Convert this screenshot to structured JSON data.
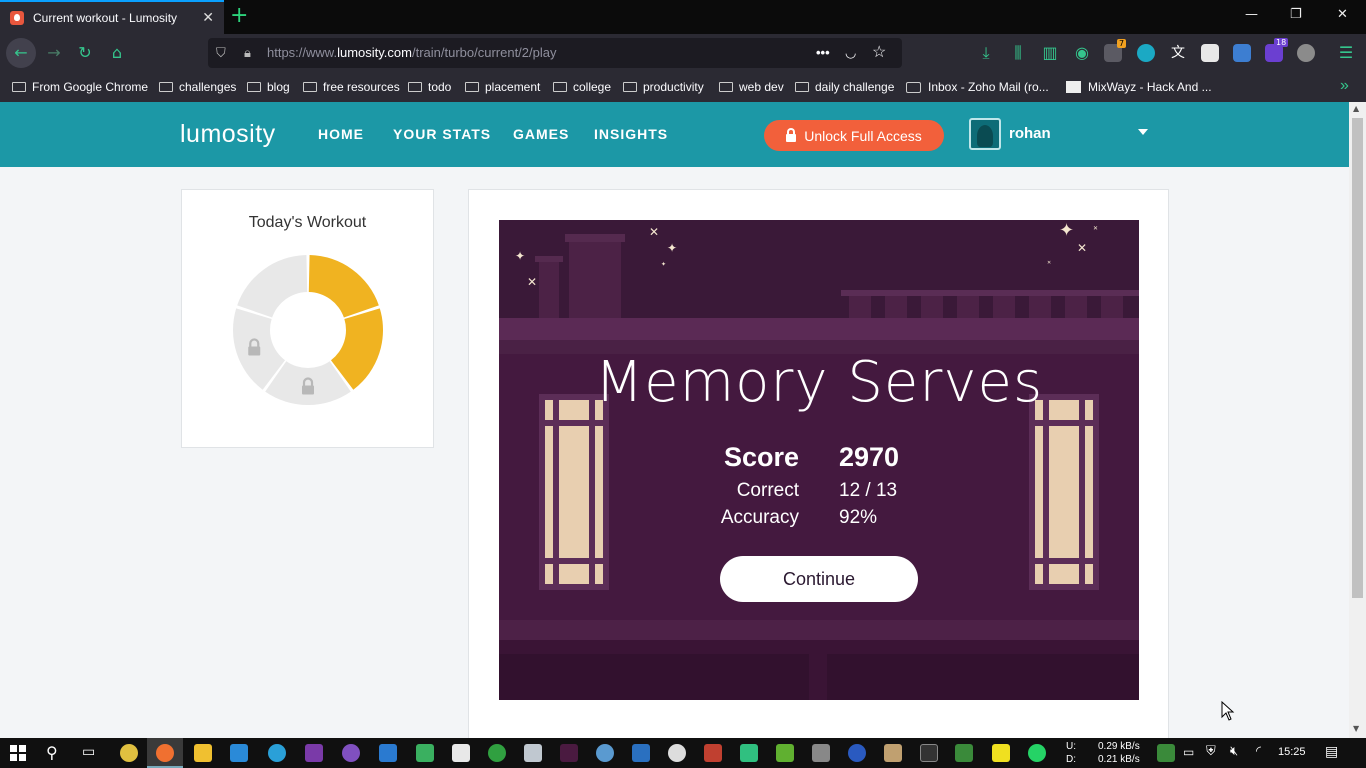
{
  "browser": {
    "tab_title": "Current workout - Lumosity",
    "url_prefix": "https://www.",
    "url_domain": "lumosity.com",
    "url_path": "/train/turbo/current/2/play",
    "notification_count": "7",
    "ext_badge": "18",
    "bookmarks": [
      {
        "label": "From Google Chrome",
        "type": "folder"
      },
      {
        "label": "challenges",
        "type": "folder"
      },
      {
        "label": "blog",
        "type": "folder"
      },
      {
        "label": "free resources",
        "type": "folder"
      },
      {
        "label": "todo",
        "type": "folder"
      },
      {
        "label": "placement",
        "type": "folder"
      },
      {
        "label": "college",
        "type": "folder"
      },
      {
        "label": "productivity",
        "type": "folder"
      },
      {
        "label": "web dev",
        "type": "folder"
      },
      {
        "label": "daily challenge",
        "type": "folder"
      },
      {
        "label": "Inbox - Zoho Mail (ro...",
        "type": "link"
      },
      {
        "label": "MixWayz - Hack And ...",
        "type": "link"
      }
    ]
  },
  "header": {
    "logo": "lumosity",
    "nav": [
      "HOME",
      "YOUR STATS",
      "GAMES",
      "INSIGHTS"
    ],
    "unlock_label": "Unlock Full Access",
    "username": "rohan"
  },
  "workout": {
    "title": "Today's Workout",
    "segments_completed": 2,
    "segments_total": 5,
    "locked_segments": 2,
    "colors": {
      "done": "#f0b321",
      "pending": "#e8e8e8",
      "lock": "#b8b8b8"
    }
  },
  "game": {
    "title": "Memory Serves",
    "score_label": "Score",
    "score_value": "2970",
    "correct_label": "Correct",
    "correct_value": "12 / 13",
    "accuracy_label": "Accuracy",
    "accuracy_value": "92%",
    "continue_label": "Continue"
  },
  "taskbar": {
    "upload_label": "U:",
    "download_label": "D:",
    "upload_speed": "0.29 kB/s",
    "download_speed": "0.21 kB/s",
    "time": "15:25"
  },
  "colors": {
    "brand_teal": "#1c98a6",
    "unlock_orange": "#f2603b",
    "game_bg": "#3f1a3b"
  }
}
